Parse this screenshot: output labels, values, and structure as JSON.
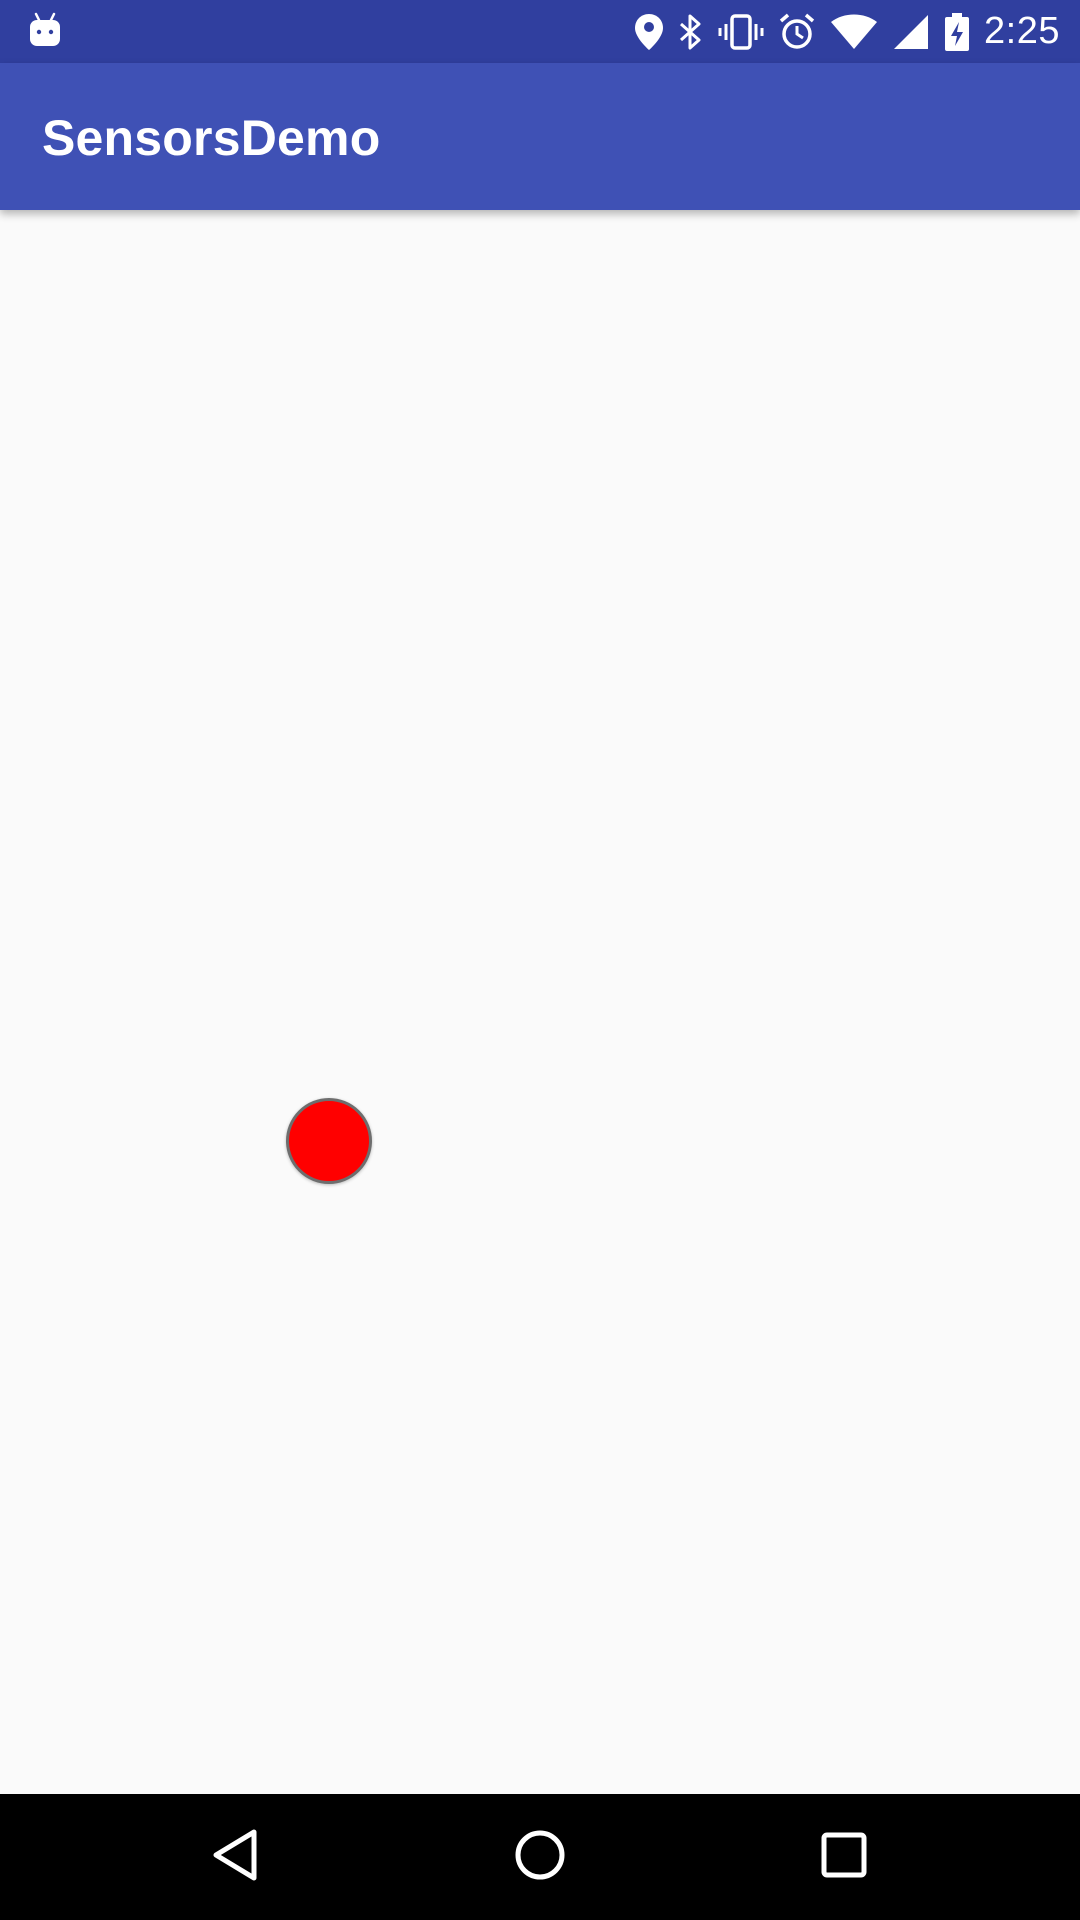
{
  "status_bar": {
    "time": "2:25",
    "icons": [
      "android-icon",
      "location-icon",
      "bluetooth-icon",
      "vibrate-icon",
      "alarm-icon",
      "wifi-icon",
      "signal-icon",
      "battery-charging-icon"
    ]
  },
  "app_bar": {
    "title": "SensorsDemo",
    "color": "#3f51b5",
    "status_color": "#303f9f"
  },
  "content": {
    "ball_color": "#ff0000",
    "background": "#fafafa"
  },
  "nav_bar": {
    "buttons": [
      "back-icon",
      "home-icon",
      "recents-icon"
    ]
  }
}
